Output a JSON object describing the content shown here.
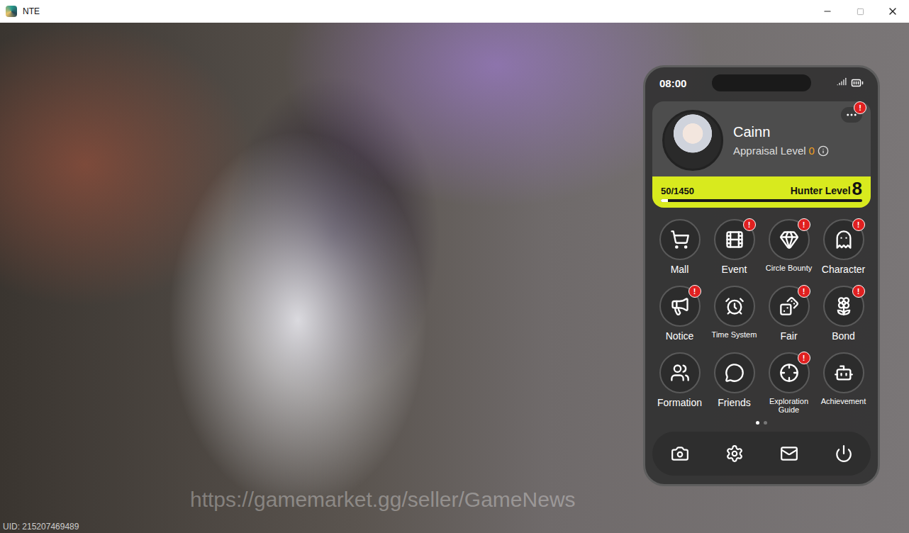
{
  "window": {
    "title": "NTE"
  },
  "overlay": {
    "watermark": "https://gamemarket.gg/seller/GameNews",
    "uid": "UID: 215207469489"
  },
  "phone": {
    "time": "08:00",
    "alert_mark": "!",
    "profile": {
      "name": "Cainn",
      "appraisal_label": "Appraisal Level",
      "appraisal_value": "0",
      "more_alert": true,
      "xp": "50/1450",
      "hunter_label": "Hunter Level",
      "hunter_value": "8",
      "level": 0.034
    },
    "apps": [
      {
        "label": "Mall",
        "alert": false
      },
      {
        "label": "Event",
        "alert": true
      },
      {
        "label": "Circle Bounty",
        "alert": true
      },
      {
        "label": "Character",
        "alert": true
      },
      {
        "label": "Notice",
        "alert": true
      },
      {
        "label": "Time System",
        "alert": false
      },
      {
        "label": "Fair",
        "alert": true
      },
      {
        "label": "Bond",
        "alert": true
      },
      {
        "label": "Formation",
        "alert": false
      },
      {
        "label": "Friends",
        "alert": false
      },
      {
        "label": "Exploration Guide",
        "alert": true
      },
      {
        "label": "Achievement",
        "alert": false
      }
    ],
    "pages": [
      {
        "selected": true
      },
      {
        "selected": false
      }
    ]
  }
}
